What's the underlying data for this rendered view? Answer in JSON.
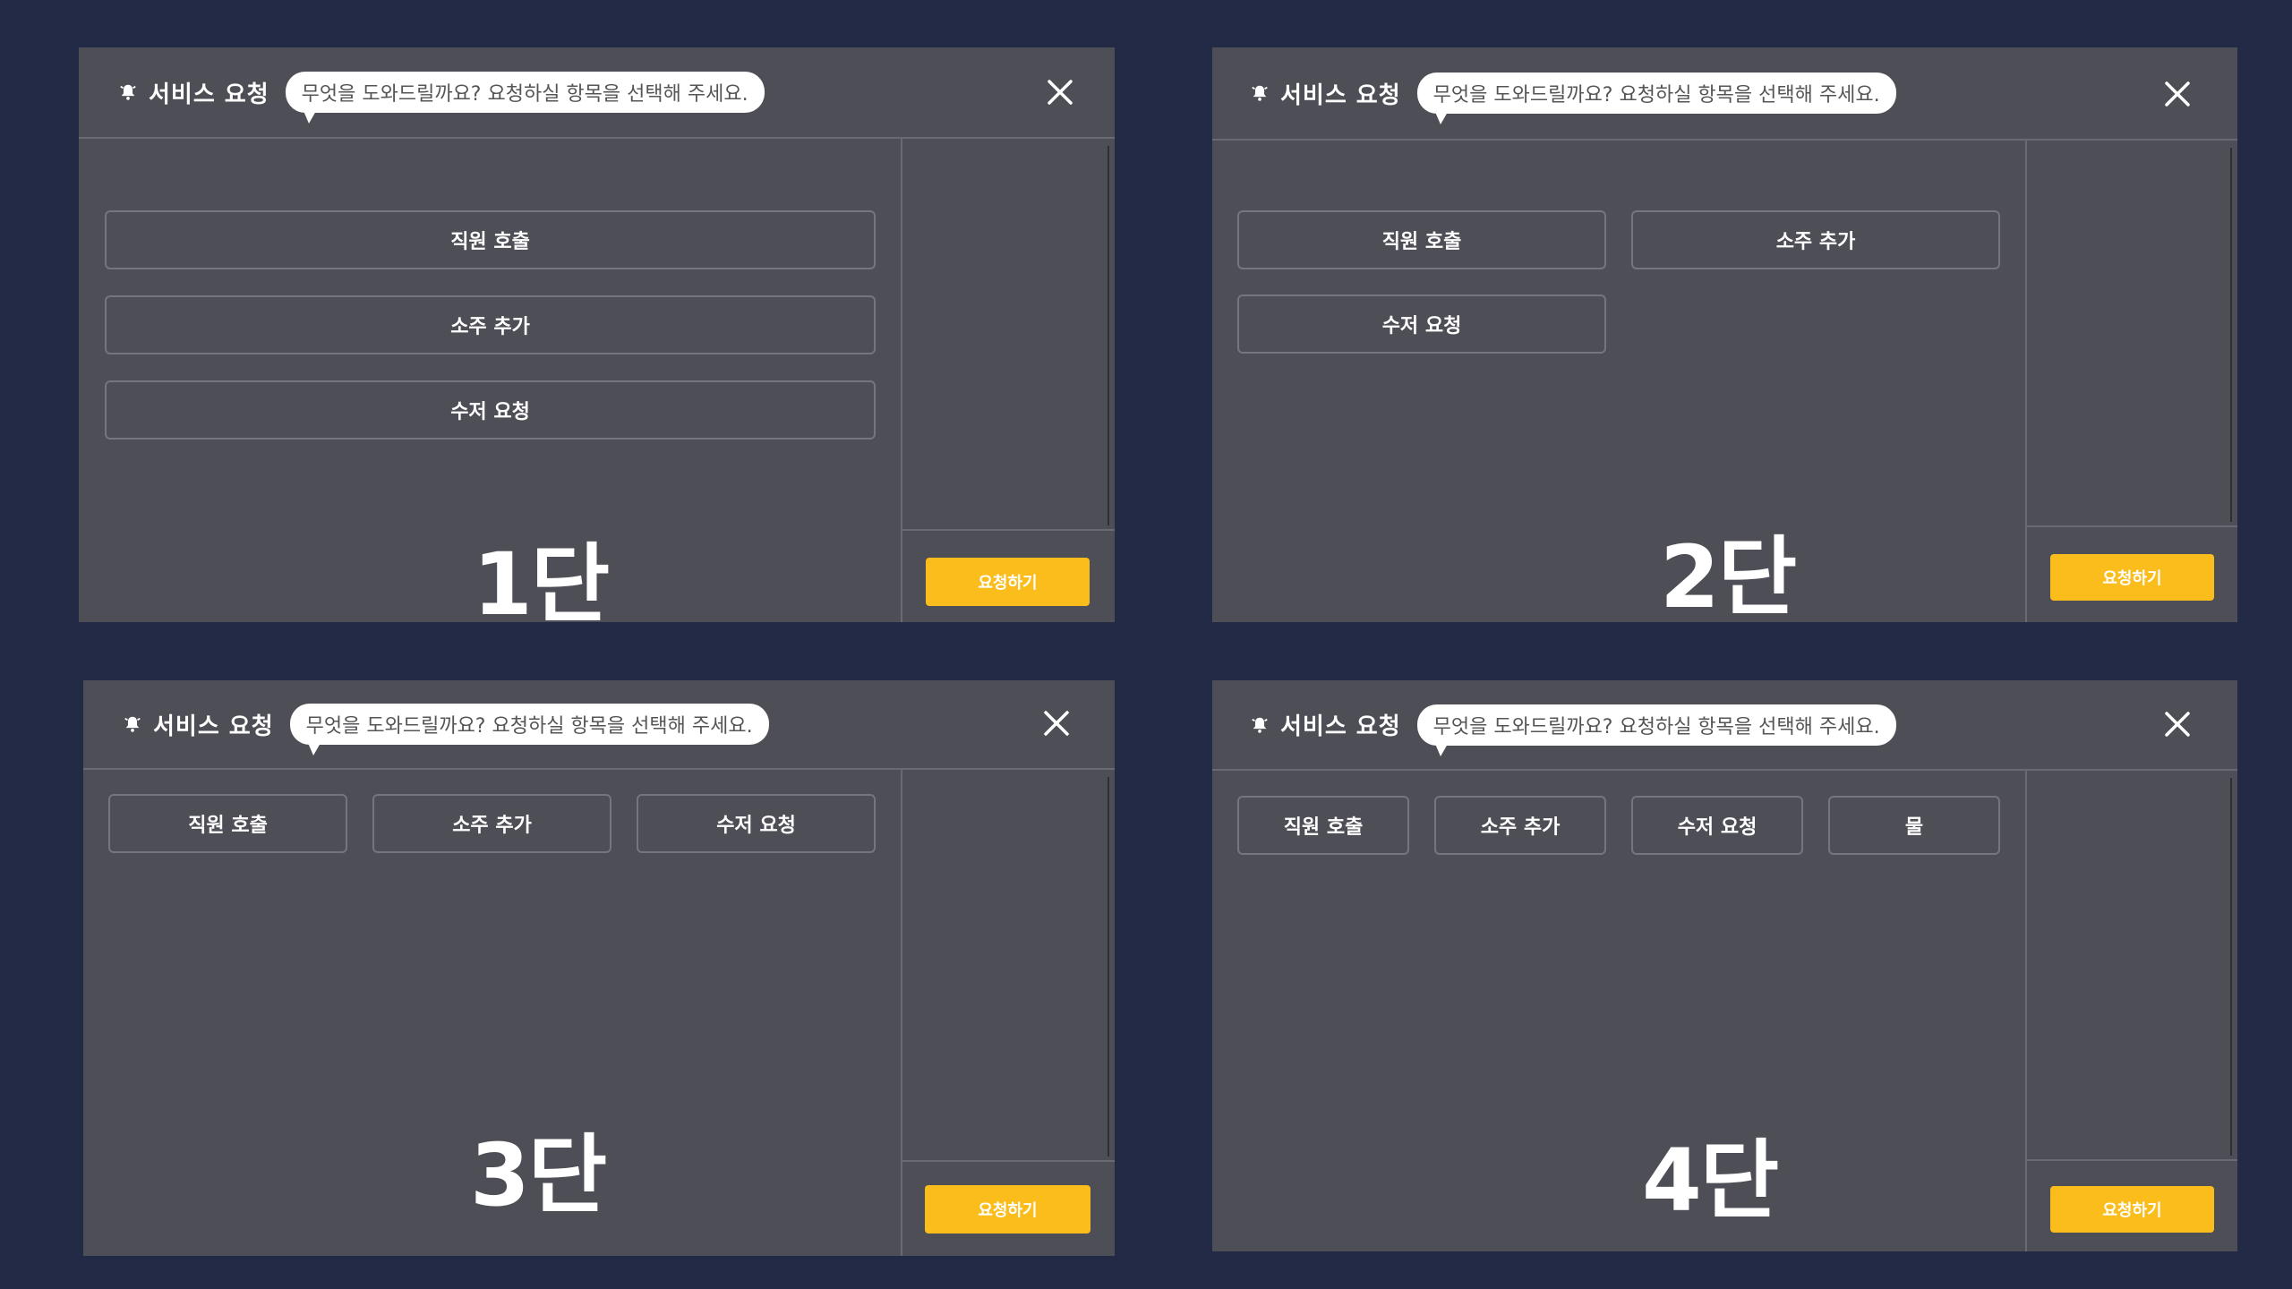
{
  "dialog": {
    "title": "서비스 요청",
    "prompt": "무엇을 도와드릴까요? 요청하실 항목을 선택해 주세요.",
    "request_button": "요청하기",
    "close_icon": "close-icon",
    "bell_icon": "bell-icon"
  },
  "options": [
    "직원 호출",
    "소주 추가",
    "수저 요청",
    "물"
  ],
  "layouts": [
    {
      "label": "1단",
      "columns": 1
    },
    {
      "label": "2단",
      "columns": 2
    },
    {
      "label": "3단",
      "columns": 3
    },
    {
      "label": "4단",
      "columns": 4
    }
  ],
  "colors": {
    "background": "#222a45",
    "panel": "#4e4e57",
    "accent": "#fbbd1c",
    "text": "#ffffff"
  }
}
